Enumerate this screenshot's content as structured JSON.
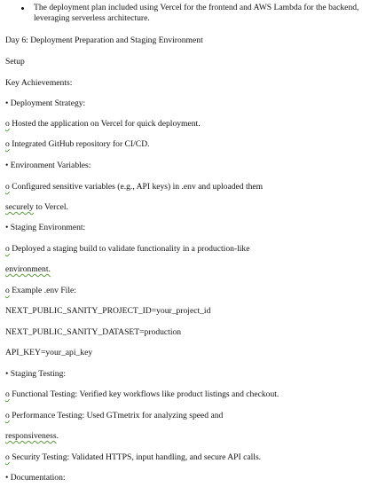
{
  "intro_bullet": "The deployment plan included using Vercel for the frontend and AWS Lambda for the backend, leveraging serverless architecture.",
  "day_heading": "Day 6: Deployment Preparation and Staging Environment",
  "setup": "Setup",
  "key_achievements": "Key Achievements:",
  "deployment_strategy": "• Deployment Strategy:",
  "o_mark": "o",
  "ds_item1": " Hosted the application on Vercel for quick deployment.",
  "ds_item2": " Integrated GitHub repository for CI/CD.",
  "environment_variables": "• Environment Variables:",
  "ev_item1": " Configured sensitive variables (e.g., API keys) in .env and uploaded them",
  "ev_item1_cont_word": "securely",
  "ev_item1_cont_rest": " to Vercel.",
  "staging_environment": "• Staging Environment:",
  "se_item1": " Deployed a staging build to validate functionality in a production-like",
  "se_item1_cont": "environment.",
  "se_item1_cont_tail": ".",
  "example_env": " Example .env File:",
  "env_line1": "NEXT_PUBLIC_SANITY_PROJECT_ID=your_project_id",
  "env_line2": "NEXT_PUBLIC_SANITY_DATASET=production",
  "env_line3": "API_KEY=your_api_key",
  "staging_testing": "• Staging Testing:",
  "st_item1": " Functional Testing: Verified key workflows like product listings and checkout.",
  "st_item2": " Performance Testing: Used GTmetrix for analyzing speed and",
  "st_item2_cont": "responsiveness",
  "st_item3": " Security Testing: Validated HTTPS, input handling, and secure API calls.",
  "documentation": "• Documentation:"
}
